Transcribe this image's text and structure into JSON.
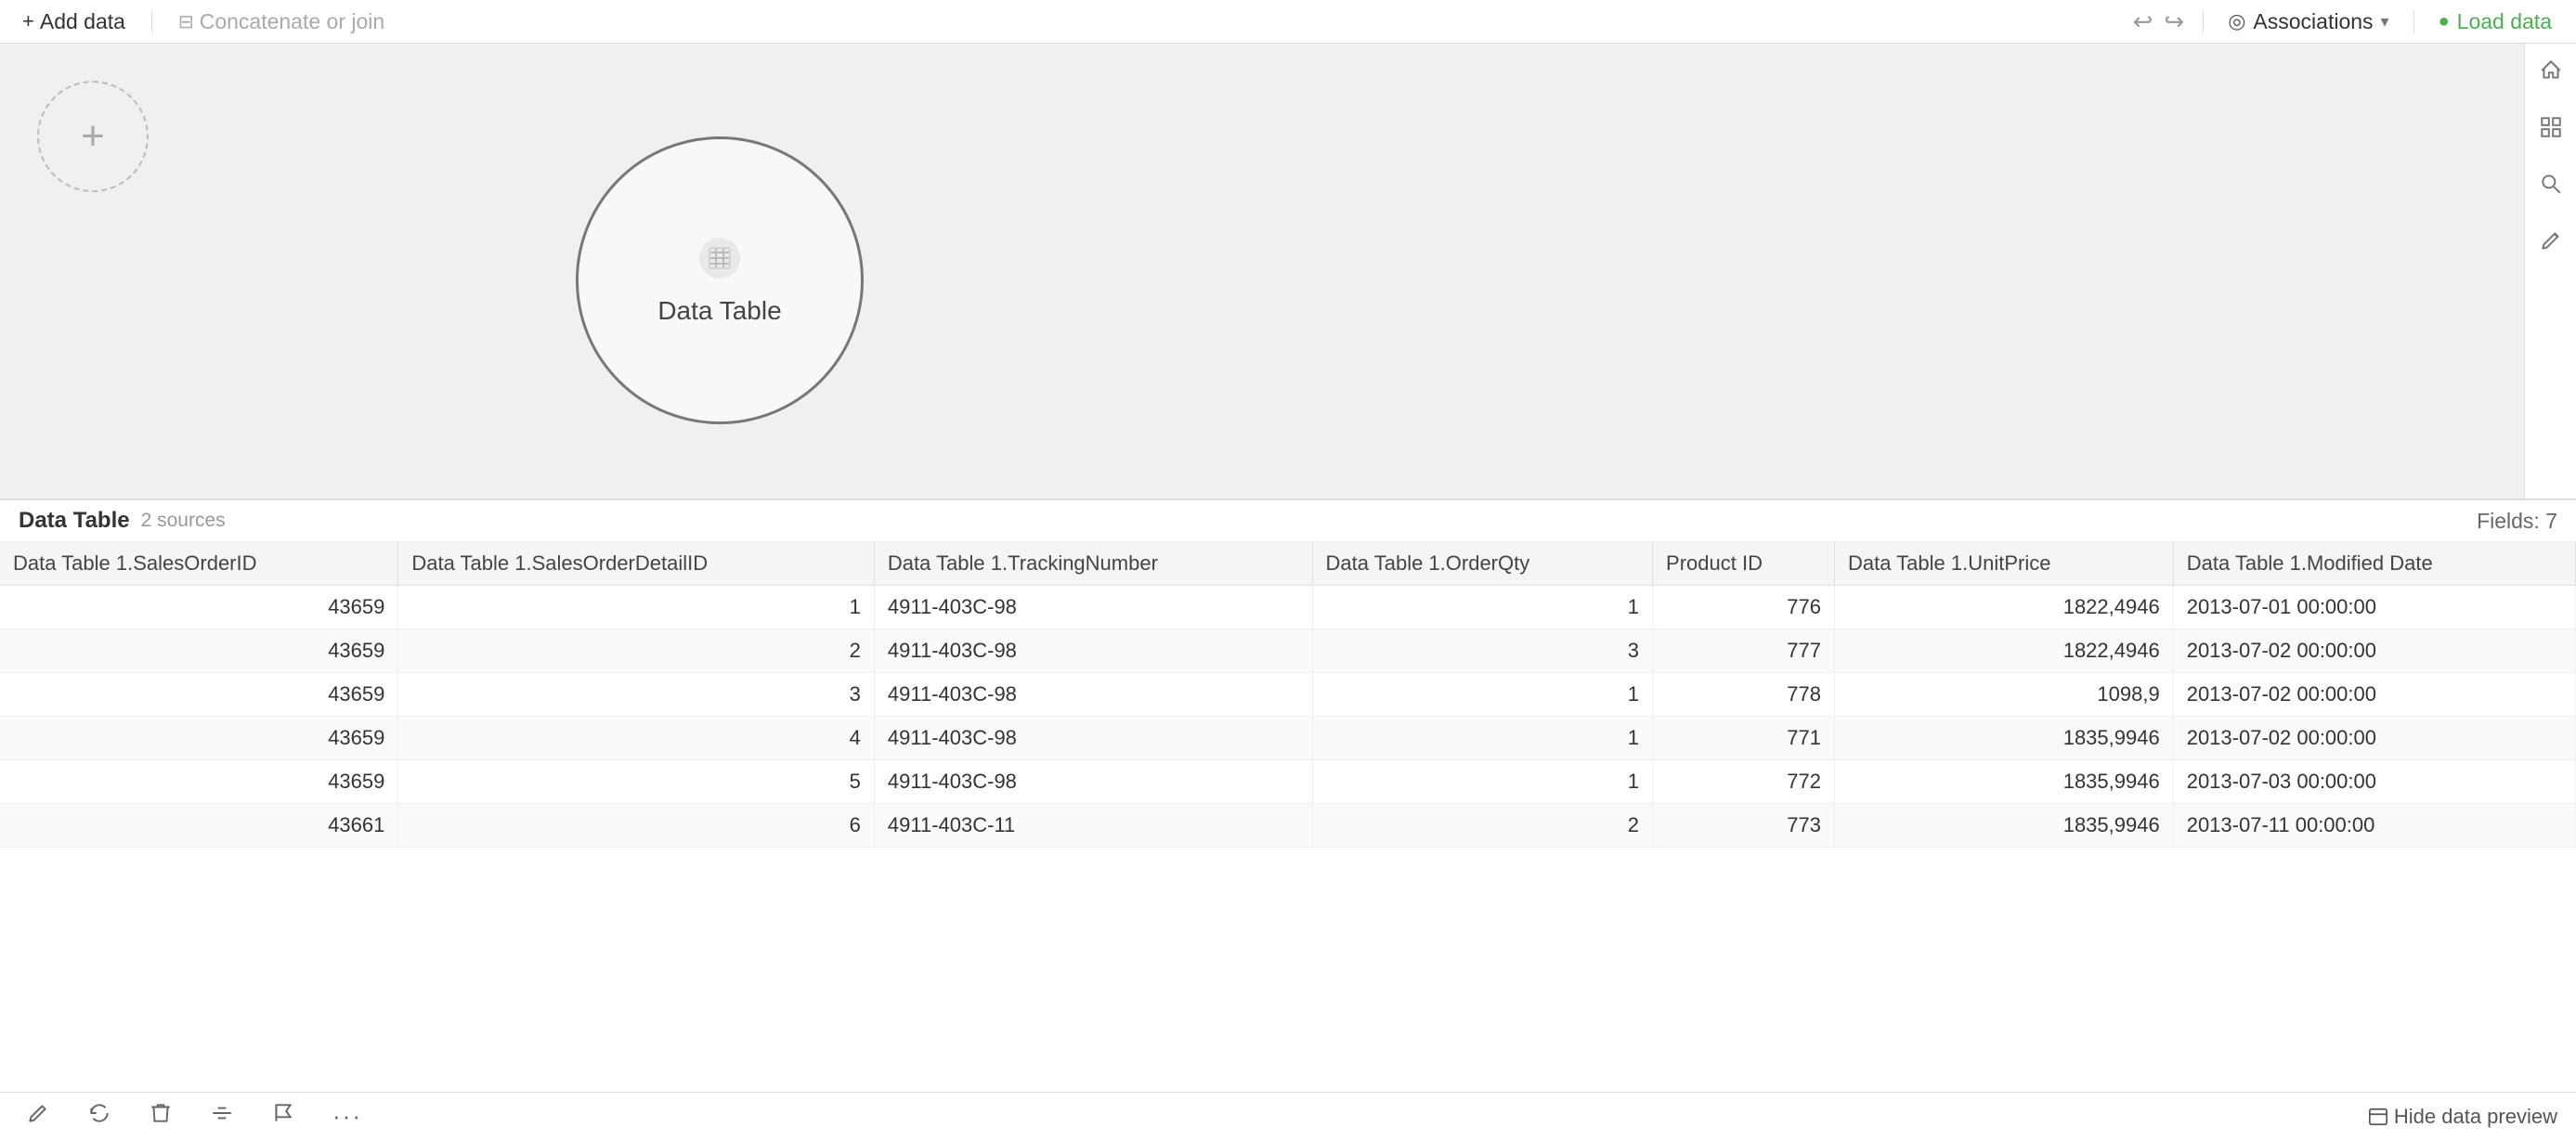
{
  "toolbar": {
    "add_data_label": "Add data",
    "concatenate_label": "Concatenate or join",
    "associations_label": "Associations",
    "load_data_label": "Load data"
  },
  "canvas": {
    "add_data_plus": "+",
    "data_table_label": "Data Table"
  },
  "bottom_panel": {
    "table_name": "Data Table",
    "sources_label": "2 sources",
    "fields_label": "Fields: 7",
    "hide_preview_label": "Hide data preview"
  },
  "table": {
    "columns": [
      "Data Table 1.SalesOrderID",
      "Data Table 1.SalesOrderDetailID",
      "Data Table 1.TrackingNumber",
      "Data Table 1.OrderQty",
      "Product ID",
      "Data Table 1.UnitPrice",
      "Data Table 1.Modified Date"
    ],
    "rows": [
      [
        "43659",
        "1",
        "4911-403C-98",
        "1",
        "776",
        "1822,4946",
        "2013-07-01 00:00:00"
      ],
      [
        "43659",
        "2",
        "4911-403C-98",
        "3",
        "777",
        "1822,4946",
        "2013-07-02 00:00:00"
      ],
      [
        "43659",
        "3",
        "4911-403C-98",
        "1",
        "778",
        "1098,9",
        "2013-07-02 00:00:00"
      ],
      [
        "43659",
        "4",
        "4911-403C-98",
        "1",
        "771",
        "1835,9946",
        "2013-07-02 00:00:00"
      ],
      [
        "43659",
        "5",
        "4911-403C-98",
        "1",
        "772",
        "1835,9946",
        "2013-07-03 00:00:00"
      ],
      [
        "43661",
        "6",
        "4911-403C-11",
        "2",
        "773",
        "1835,9946",
        "2013-07-11 00:00:00"
      ]
    ]
  },
  "icons": {
    "home": "⌂",
    "grid": "⊞",
    "search": "🔍",
    "pencil_sidebar": "✏",
    "undo": "↩",
    "redo": "↪",
    "eye": "◎",
    "chevron_down": "▾",
    "green_circle": "●",
    "edit_pencil": "✎",
    "refresh": "↻",
    "trash": "🗑",
    "filter": "⧉",
    "flag": "⚑",
    "more": "⋯",
    "data_icon": "◎"
  }
}
